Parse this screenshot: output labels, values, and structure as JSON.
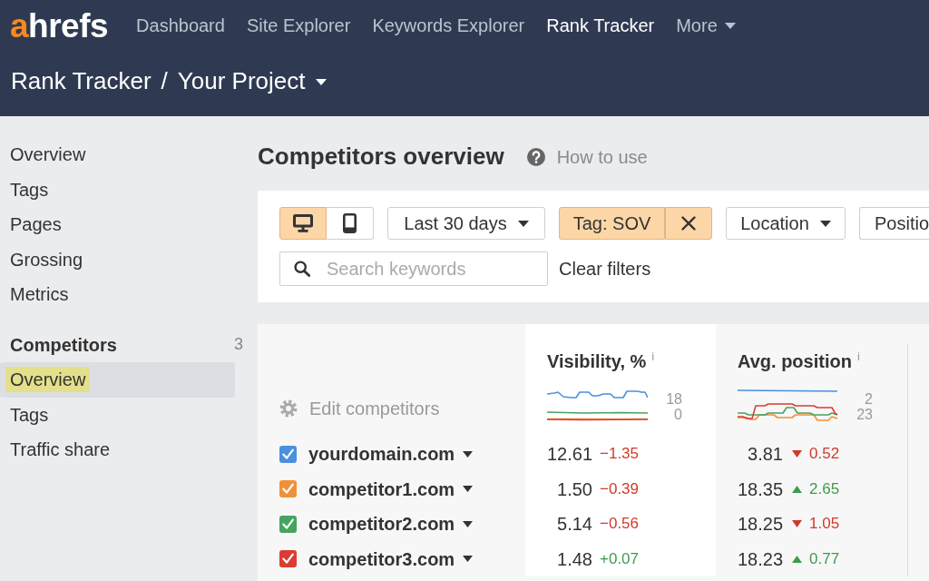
{
  "top_nav": {
    "logo": [
      {
        "text": "a",
        "kind": "accent"
      },
      {
        "text": "hrefs",
        "kind": "plain"
      }
    ],
    "items": [
      {
        "label": "Dashboard",
        "selected": false,
        "kind": "link"
      },
      {
        "label": "Site Explorer",
        "selected": false,
        "kind": "link"
      },
      {
        "label": "Keywords Explorer",
        "selected": false,
        "kind": "link"
      },
      {
        "label": "Rank Tracker",
        "selected": true,
        "kind": "link"
      },
      {
        "label": "More",
        "selected": false,
        "kind": "dropdown"
      }
    ]
  },
  "breadcrumb": {
    "items": [
      {
        "label": "Rank Tracker",
        "kind": "link"
      },
      {
        "label": "Your Project",
        "kind": "dropdown"
      }
    ],
    "separator": "/"
  },
  "sidebar": {
    "sections": [
      {
        "items": [
          {
            "label": "Overview",
            "selected": false,
            "highlighted": false
          },
          {
            "label": "Tags",
            "selected": false,
            "highlighted": false
          },
          {
            "label": "Pages",
            "selected": false,
            "highlighted": false
          },
          {
            "label": "Grossing",
            "selected": false,
            "highlighted": false
          },
          {
            "label": "Metrics",
            "selected": false,
            "highlighted": false
          }
        ]
      },
      {
        "title": "Competitors",
        "count": "3",
        "items": [
          {
            "label": "Overview",
            "selected": true,
            "highlighted": true
          },
          {
            "label": "Tags",
            "selected": false,
            "highlighted": false
          },
          {
            "label": "Traffic share",
            "selected": false,
            "highlighted": false
          }
        ]
      }
    ]
  },
  "page": {
    "title": "Competitors overview",
    "help_link": "How to use"
  },
  "filters": {
    "devices": [
      {
        "kind": "desktop",
        "selected": true
      },
      {
        "kind": "mobile",
        "selected": false
      }
    ],
    "buttons": [
      {
        "kind": "dropdown",
        "label": "Last 30 days",
        "active": false
      },
      {
        "kind": "chip",
        "label": "Tag: SOV",
        "active": true
      },
      {
        "kind": "dropdown",
        "label": "Location",
        "active": false
      },
      {
        "kind": "plain",
        "label": "Positio",
        "active": false
      }
    ],
    "search": {
      "placeholder": "Search keywords"
    },
    "clear_filters": "Clear filters"
  },
  "table": {
    "edit_competitors": "Edit competitors",
    "columns": [
      {
        "title": "Visibility, %",
        "info": "i",
        "kind": "visibility",
        "highlighted": true,
        "sparkline_labels": [
          "18",
          "0"
        ]
      },
      {
        "title": "Avg. position",
        "info": "i",
        "kind": "position",
        "highlighted": false,
        "sparkline_labels": [
          "2",
          "23"
        ]
      }
    ],
    "rows": [
      {
        "domain": "yourdomain.com",
        "checked": true,
        "color": "#4a8fe0",
        "values": [
          {
            "value": "12.61",
            "change": "−1.35",
            "positive": false
          },
          {
            "value": "3.81",
            "change": "0.52",
            "positive": false
          }
        ]
      },
      {
        "domain": "competitor1.com",
        "checked": true,
        "color": "#f0913a",
        "values": [
          {
            "value": "1.50",
            "change": "−0.39",
            "positive": false
          },
          {
            "value": "18.35",
            "change": "2.65",
            "positive": true
          }
        ]
      },
      {
        "domain": "competitor2.com",
        "checked": true,
        "color": "#47a360",
        "values": [
          {
            "value": "5.14",
            "change": "−0.56",
            "positive": false
          },
          {
            "value": "18.25",
            "change": "1.05",
            "positive": false
          }
        ]
      },
      {
        "domain": "competitor3.com",
        "checked": true,
        "color": "#dc3c33",
        "values": [
          {
            "value": "1.48",
            "change": "+0.07",
            "positive": true
          },
          {
            "value": "18.23",
            "change": "0.77",
            "positive": true
          }
        ]
      }
    ]
  }
}
